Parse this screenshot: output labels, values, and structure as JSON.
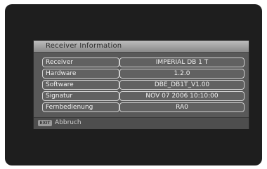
{
  "dialog": {
    "title": "Receiver  Information"
  },
  "rows": [
    {
      "label": "Receiver",
      "value": "IMPERIAL  DB  1  T"
    },
    {
      "label": "Hardware",
      "value": "1.2.0"
    },
    {
      "label": "Software",
      "value": "DBE_DB1T_V1.00"
    },
    {
      "label": "Signatur",
      "value": "NOV  07  2006  10:10:00"
    },
    {
      "label": "Fernbedienung",
      "value": "RA0"
    }
  ],
  "footer": {
    "key_badge": "EXIT",
    "action_label": "Abbruch"
  }
}
